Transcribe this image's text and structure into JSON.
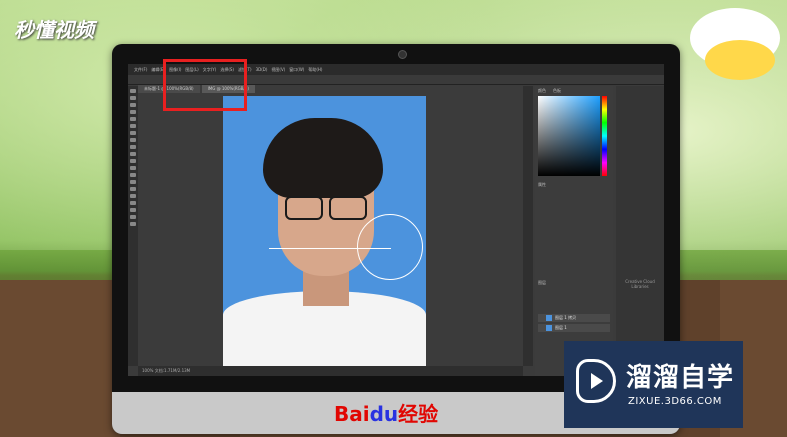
{
  "watermark_top": "秒懂视频",
  "baidu": {
    "brand": "Bai",
    "mid": "du",
    "suffix": "经验"
  },
  "badge": {
    "name": "溜溜自学",
    "url": "ZIXUE.3D66.COM"
  },
  "photoshop": {
    "menus": [
      "文件(F)",
      "编辑(E)",
      "图像(I)",
      "图层(L)",
      "文字(Y)",
      "选择(S)",
      "滤镜(T)",
      "3D(D)",
      "视图(V)",
      "窗口(W)",
      "帮助(H)"
    ],
    "tabs": [
      {
        "label": "未标题-1 @ 100%(RGB/8)",
        "active": false
      },
      {
        "label": "IMG @ 100%(RGB/8)",
        "active": true
      }
    ],
    "panels": {
      "color": "颜色",
      "swatches": "色板",
      "properties": "属性",
      "layers": "图层"
    },
    "layers": [
      {
        "name": "图层 1 拷贝"
      },
      {
        "name": "图层 1"
      }
    ],
    "statusbar": "100%  文档:1.71M/2.13M",
    "library_note": "Creative Cloud Libraries"
  },
  "colors": {
    "highlight": "#e82020",
    "badge_bg": "#1f3559",
    "photo_bg": "#4c93dd"
  }
}
